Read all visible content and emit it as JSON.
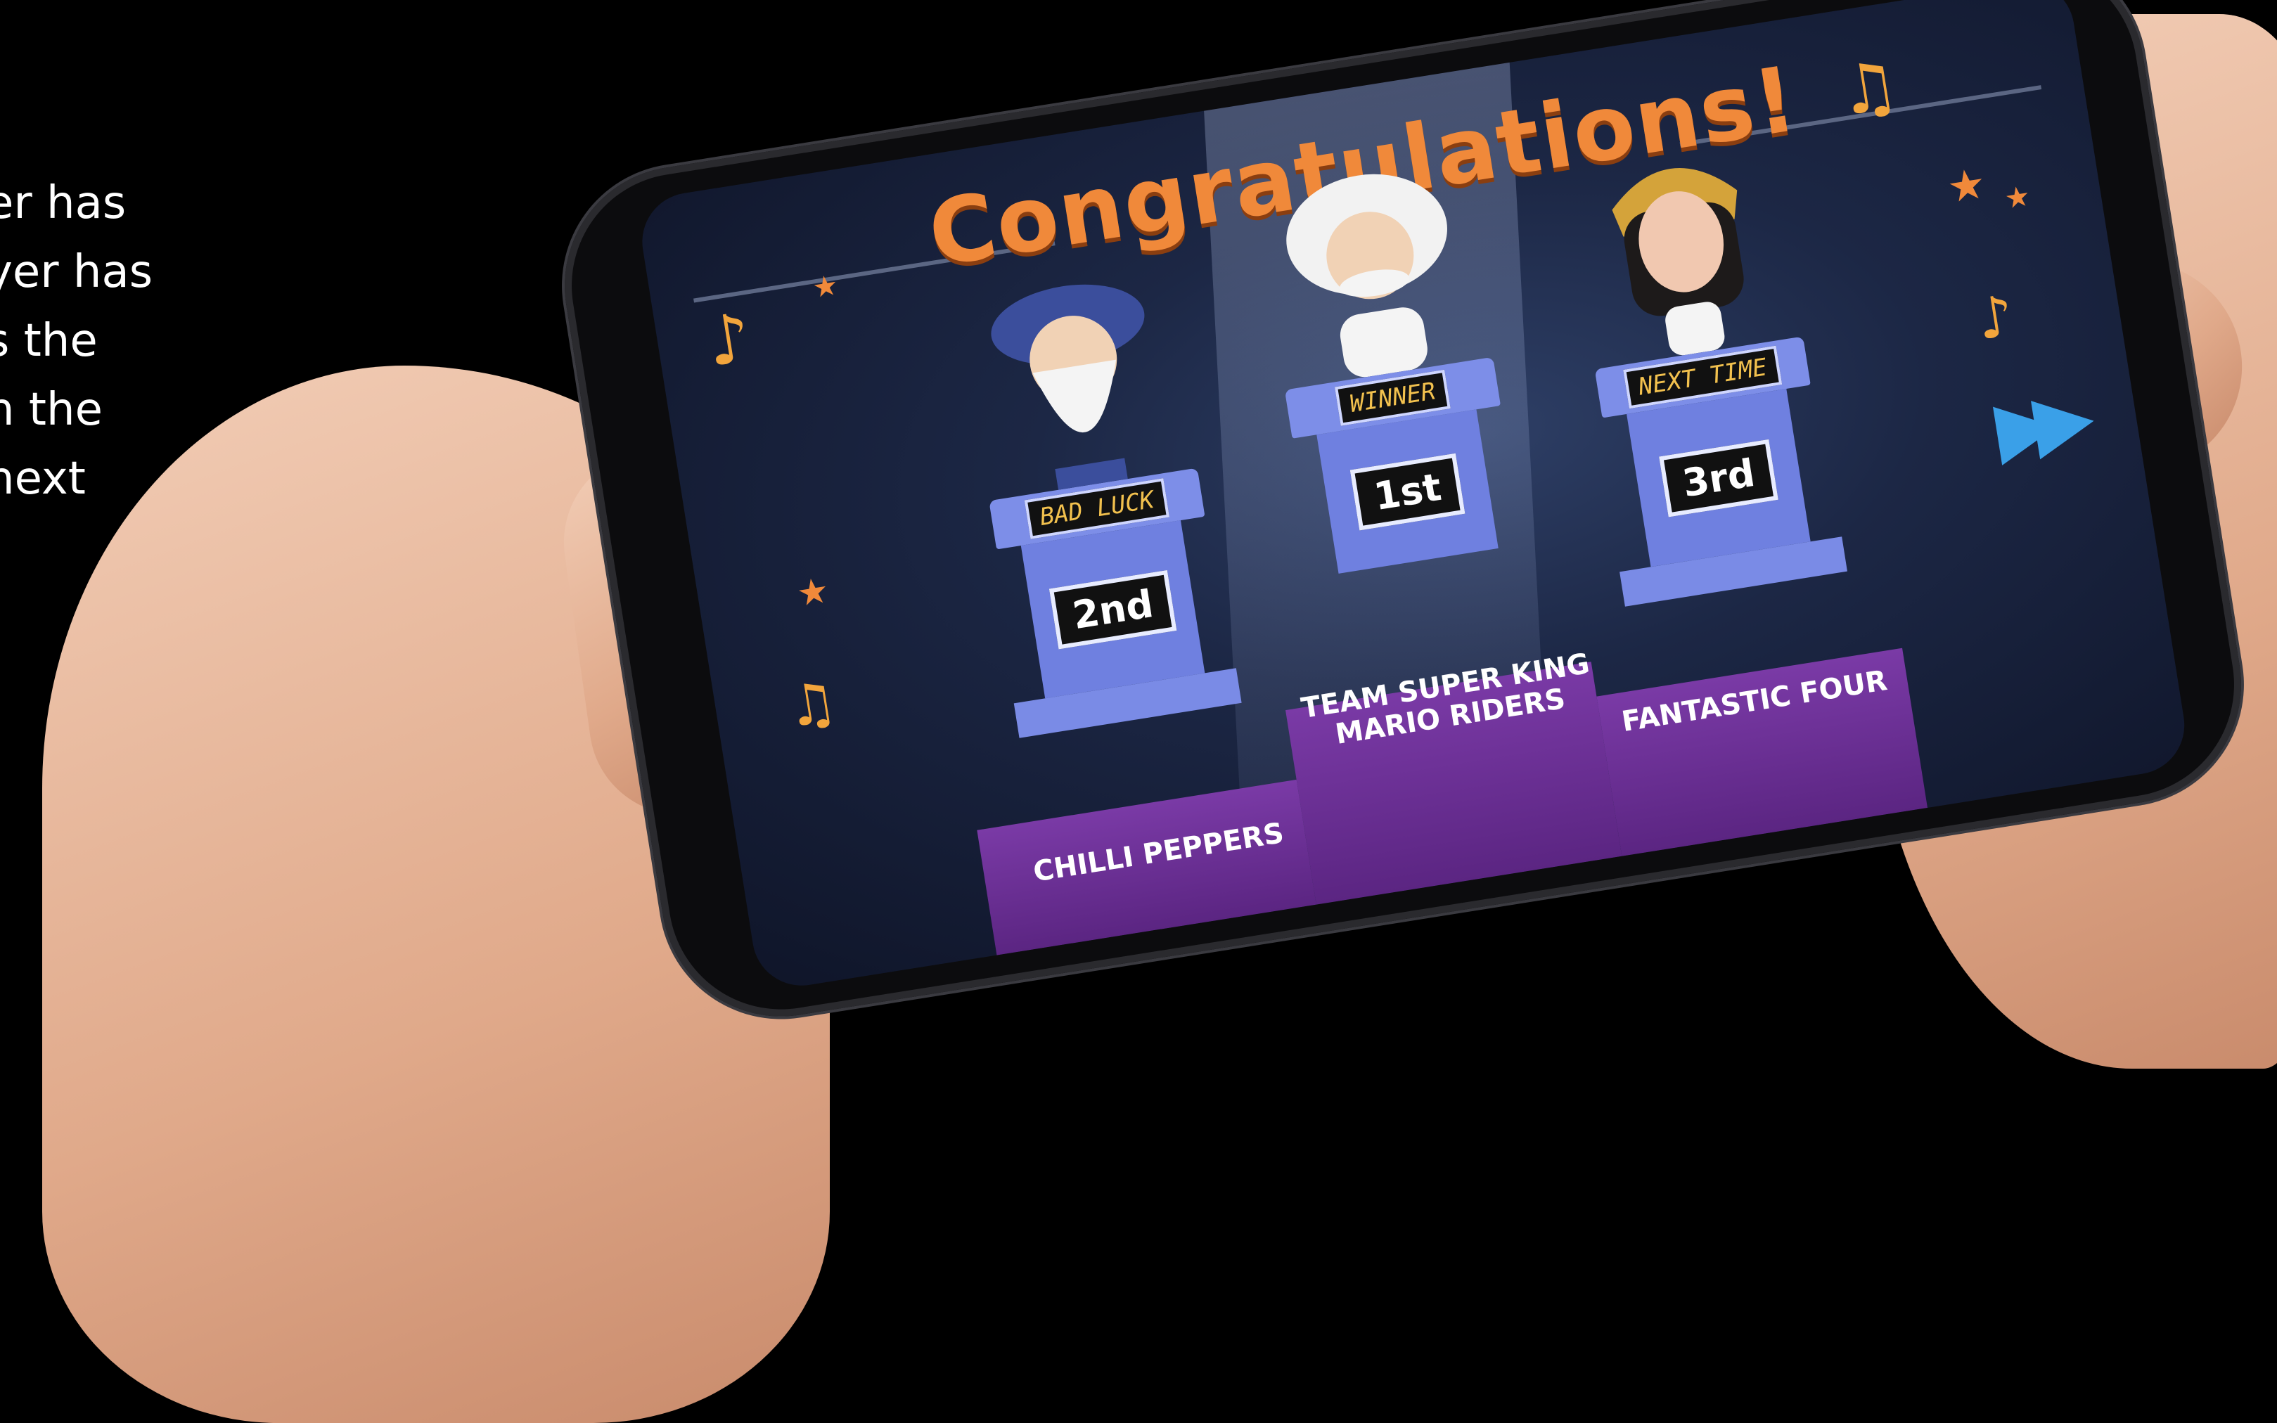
{
  "side_text": [
    "er has",
    "yer has",
    "s the",
    "n the",
    "",
    "next"
  ],
  "game": {
    "title": "Congratulations!",
    "podiums": [
      {
        "sign": "BAD LUCK",
        "rank": "2nd",
        "team": "CHILLI PEPPERS",
        "character": "bearded-wizard"
      },
      {
        "sign": "WINNER",
        "rank": "1st",
        "team_line1": "TEAM SUPER KING",
        "team_line2": "MARIO RIDERS",
        "character": "white-haired-scientist"
      },
      {
        "sign": "NEXT TIME",
        "rank": "3rd",
        "team": "FANTASTIC FOUR",
        "character": "egyptian-queen"
      }
    ],
    "next_icon": "fast-forward-icon"
  },
  "colors": {
    "title": "#f0893a",
    "stage": "#6a2d93",
    "podium": "#7283e4",
    "sign_text": "#f2c14e",
    "next": "#3aa0e8"
  }
}
